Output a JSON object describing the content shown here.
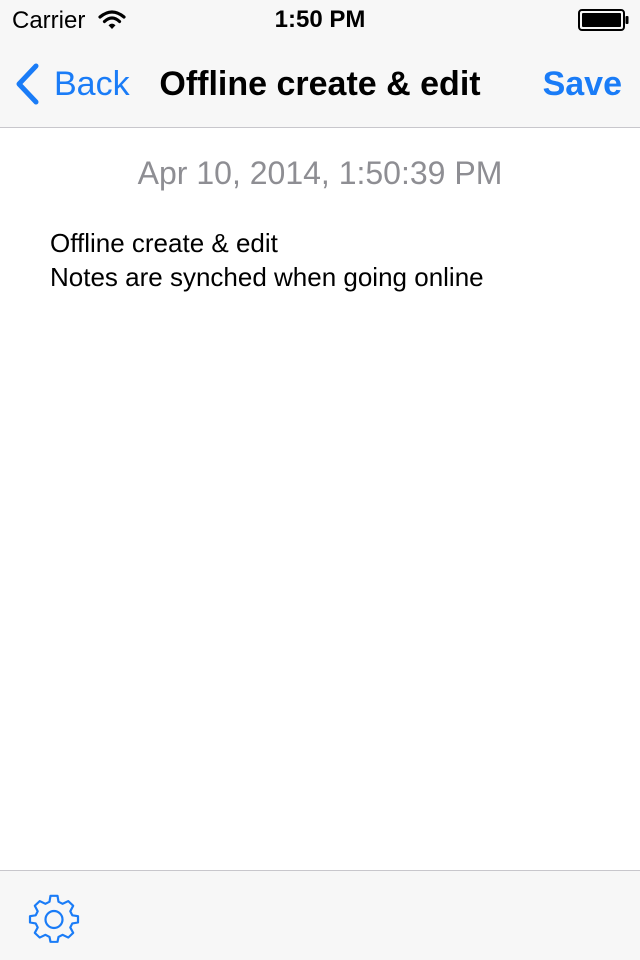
{
  "status_bar": {
    "carrier": "Carrier",
    "time": "1:50 PM",
    "wifi_icon": "wifi-icon",
    "battery_icon": "battery-icon"
  },
  "nav_bar": {
    "back_label": "Back",
    "back_icon": "chevron-left-icon",
    "title": "Offline create & edit",
    "save_label": "Save"
  },
  "note": {
    "date": "Apr 10, 2014, 1:50:39 PM",
    "lines": [
      "Offline create & edit",
      "Notes are synched when going online"
    ]
  },
  "toolbar": {
    "settings_icon": "gear-icon"
  },
  "colors": {
    "accent": "#1a7cf7",
    "bar_background": "#f7f7f7",
    "separator": "#c8c7cc",
    "date_text": "#8e8e93"
  }
}
